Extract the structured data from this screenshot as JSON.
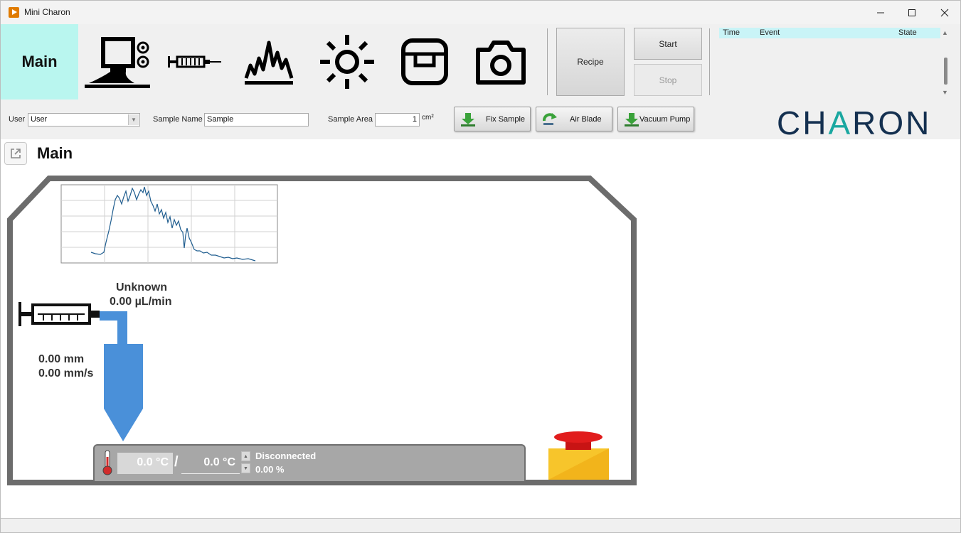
{
  "window": {
    "title": "Mini Charon"
  },
  "toolbar": {
    "main_label": "Main",
    "tools": [
      {
        "name": "instrument-icon"
      },
      {
        "name": "syringe-icon"
      },
      {
        "name": "spectrum-icon"
      },
      {
        "name": "sun-icon"
      },
      {
        "name": "tray-icon"
      },
      {
        "name": "camera-icon"
      }
    ],
    "recipe_label": "Recipe",
    "start_label": "Start",
    "stop_label": "Stop"
  },
  "event_log": {
    "columns": [
      "Time",
      "Event",
      "State"
    ]
  },
  "inputs": {
    "user_label": "User",
    "user_value": "User",
    "sample_name_label": "Sample Name",
    "sample_name_value": "Sample",
    "sample_area_label": "Sample Area",
    "sample_area_value": "1",
    "sample_area_unit": "cm²"
  },
  "actions": {
    "fix_sample": "Fix Sample",
    "air_blade": "Air Blade",
    "vacuum_pump": "Vacuum Pump"
  },
  "logo": {
    "text": "CHARON"
  },
  "page": {
    "title": "Main"
  },
  "diagram": {
    "pump_state": "Unknown",
    "flow_rate": "0.00 µL/min",
    "position": "0.00 mm",
    "speed": "0.00 mm/s",
    "temp_actual": "0.0 °C",
    "temp_separator": "/",
    "temp_setpoint": "0.0 °C",
    "connection_status": "Disconnected",
    "power_percent": "0.00 %"
  },
  "colors": {
    "accent_tab": "#b9f6ef",
    "nozzle_blue": "#4a90d9",
    "logo_navy": "#143050",
    "logo_teal": "#1aa7a0",
    "estop_red": "#e11d1d",
    "estop_yellow": "#f7c52b",
    "plot_line": "#1f5d8f"
  }
}
